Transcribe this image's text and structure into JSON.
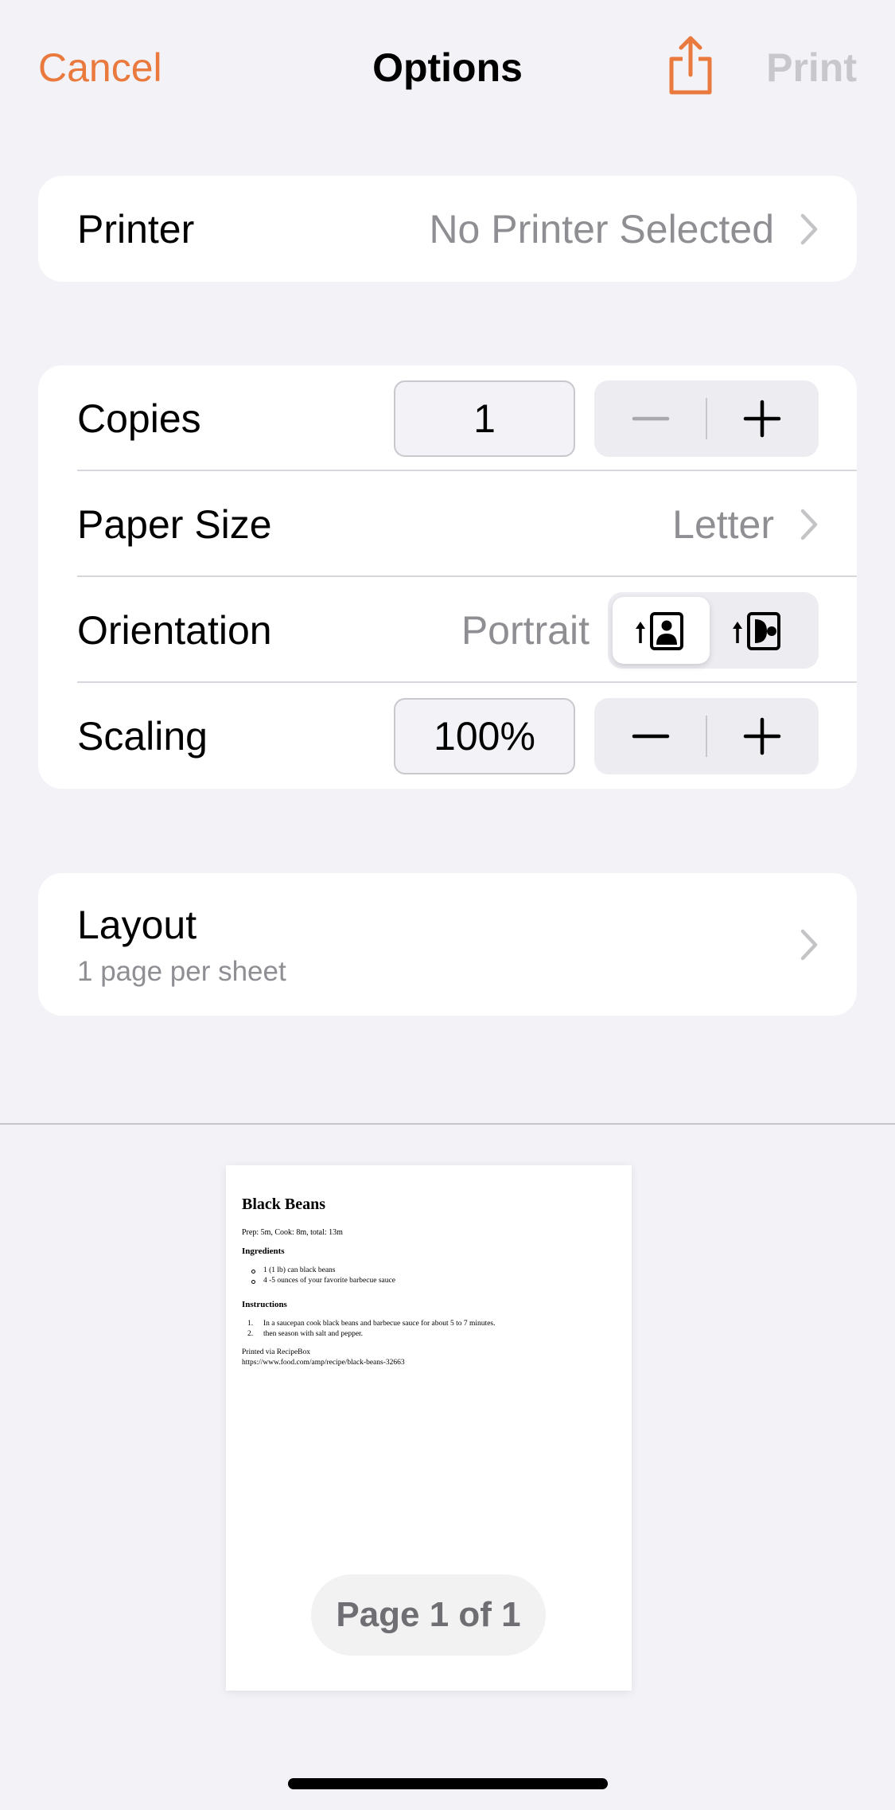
{
  "nav": {
    "cancel_label": "Cancel",
    "title": "Options",
    "share_icon": "share-icon",
    "print_label": "Print"
  },
  "printer": {
    "label": "Printer",
    "value": "No Printer Selected"
  },
  "options": {
    "copies": {
      "label": "Copies",
      "value": "1"
    },
    "paper_size": {
      "label": "Paper Size",
      "value": "Letter"
    },
    "orientation": {
      "label": "Orientation",
      "value": "Portrait",
      "options": [
        "portrait-icon",
        "landscape-icon"
      ],
      "selected": "portrait-icon"
    },
    "scaling": {
      "label": "Scaling",
      "value": "100%"
    }
  },
  "layout": {
    "label": "Layout",
    "value": "1 page per sheet"
  },
  "preview": {
    "title": "Black Beans",
    "meta": "Prep: 5m, Cook: 8m, total: 13m",
    "ingredients_heading": "Ingredients",
    "ingredients": [
      "1 (1 lb) can black beans",
      "4 -5 ounces of your favorite barbecue sauce"
    ],
    "instructions_heading": "Instructions",
    "instructions": [
      "In a saucepan cook black beans and barbecue sauce for about 5 to 7 minutes.",
      "then season with salt and pepper."
    ],
    "footer_line1": "Printed via RecipeBox",
    "footer_line2": "https://www.food.com/amp/recipe/black-beans-32663",
    "page_indicator": "Page 1 of 1"
  },
  "colors": {
    "accent": "#e9793d",
    "background": "#f2f2f7",
    "secondary_text": "#8e8e93",
    "disabled": "#c7c7cc"
  }
}
